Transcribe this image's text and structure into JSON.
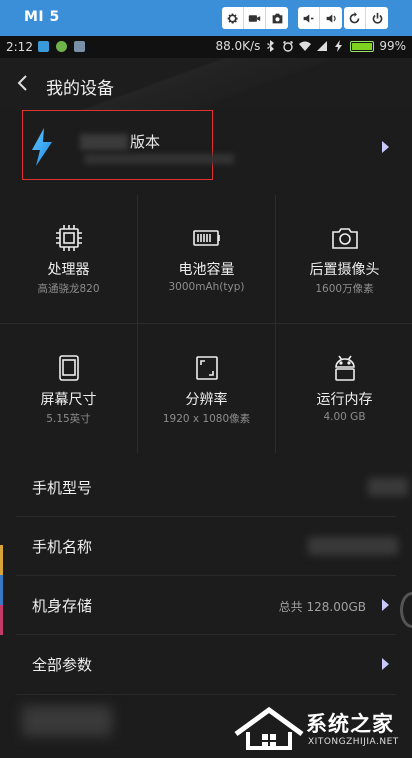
{
  "emulator": {
    "title": "MI 5",
    "accent": "#3b8fd9",
    "buttons": [
      "settings-icon",
      "record-icon",
      "camera-icon",
      "volume-down-icon",
      "volume-up-icon",
      "rotate-icon",
      "power-icon"
    ]
  },
  "status_bar": {
    "time": "2:12",
    "speed": "88.0K/s",
    "battery": "99%",
    "battery_level": 0.99
  },
  "header": {
    "title": "我的设备"
  },
  "version_card": {
    "label": "版本",
    "highlight_color": "#e0322f"
  },
  "specs": [
    {
      "name": "处理器",
      "value": "高通骁龙820",
      "icon": "cpu-icon"
    },
    {
      "name": "电池容量",
      "value": "3000mAh(typ)",
      "icon": "battery-icon"
    },
    {
      "name": "后置摄像头",
      "value": "1600万像素",
      "icon": "camera-icon"
    },
    {
      "name": "屏幕尺寸",
      "value": "5.15英寸",
      "icon": "phone-screen-icon"
    },
    {
      "name": "分辨率",
      "value": "1920 x 1080像素",
      "icon": "resolution-icon"
    },
    {
      "name": "运行内存",
      "value": "4.00 GB",
      "icon": "android-icon"
    }
  ],
  "rows": [
    {
      "label": "手机型号",
      "value": ""
    },
    {
      "label": "手机名称",
      "value": ""
    },
    {
      "label": "机身存储",
      "value": "总共 128.00GB"
    },
    {
      "label": "全部参数",
      "value": ""
    }
  ],
  "watermark": {
    "text": "系统之家",
    "sub": "XITONGZHIJIA.NET"
  }
}
